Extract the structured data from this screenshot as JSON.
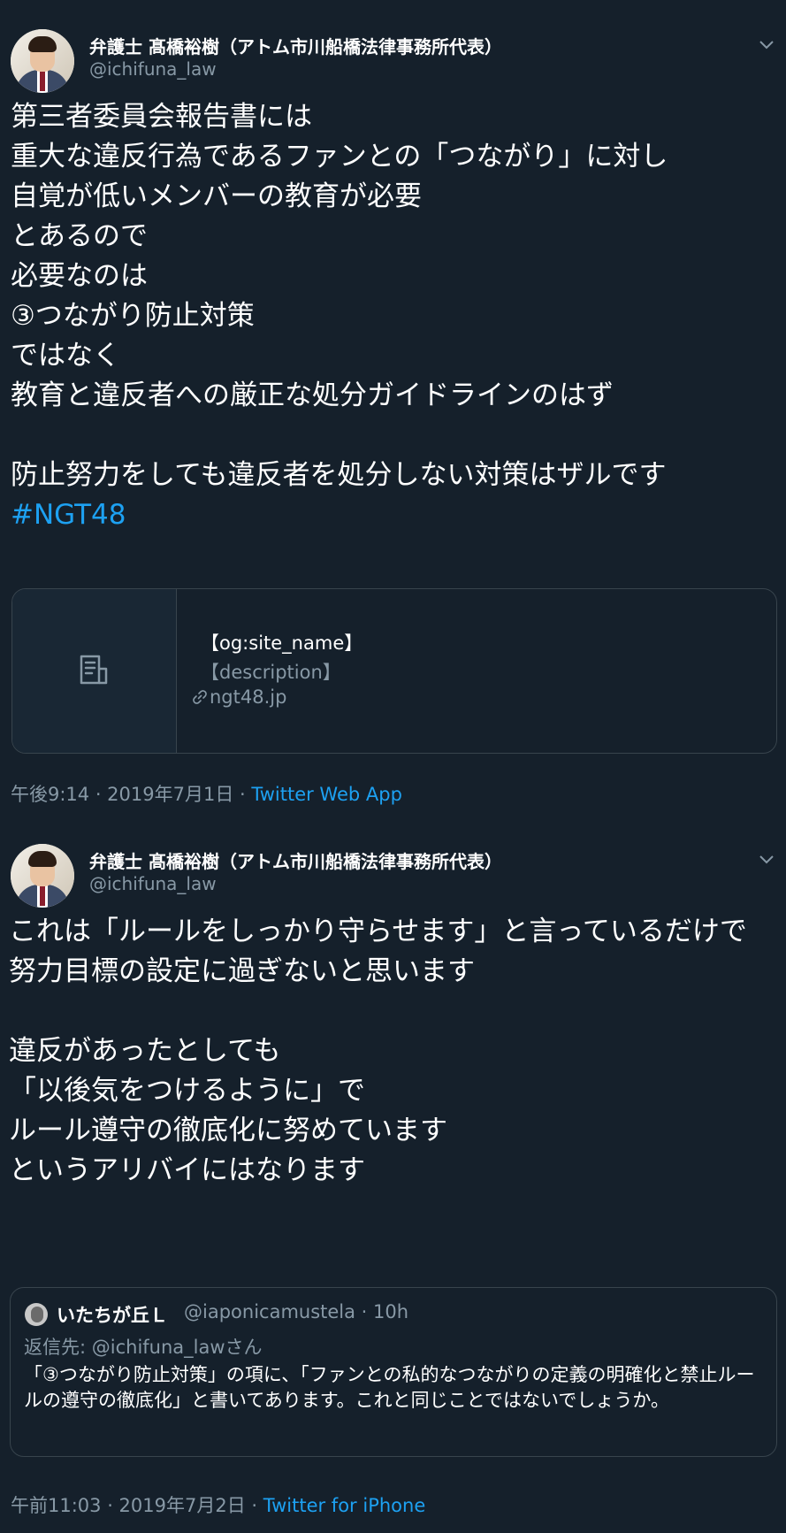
{
  "tweets": [
    {
      "name": "弁護士 髙橋裕樹（アトム市川船橋法律事務所代表）",
      "handle": "@ichifuna_law",
      "text": "第三者委員会報告書には\n重大な違反行為であるファンとの「つながり」に対し\n自覚が低いメンバーの教育が必要\nとあるので\n必要なのは\n③つながり防止対策\nではなく\n教育と違反者への厳正な処分ガイドラインのはず\n\n防止努力をしても違反者を処分しない対策はザルです\n",
      "hashtag": "#NGT48",
      "card": {
        "site_name": "【og:site_name】",
        "description": "【description】",
        "domain": "ngt48.jp"
      },
      "timestamp": "午後9:14 · 2019年7月1日 · ",
      "source": "Twitter Web App"
    },
    {
      "name": "弁護士 髙橋裕樹（アトム市川船橋法律事務所代表）",
      "handle": "@ichifuna_law",
      "text": "これは「ルールをしっかり守らせます」と言っているだけで\n努力目標の設定に過ぎないと思います\n\n違反があったとしても\n「以後気をつけるように」で\nルール遵守の徹底化に努めています\nというアリバイにはなります",
      "quote": {
        "name": "いたちが丘Ｌ",
        "handle_time": "@iaponicamustela · 10h",
        "reply_to": "返信先: @ichifuna_lawさん",
        "text": "「③つながり防止対策」の項に、「ファンとの私的なつながりの定義の明確化と禁止ルールの遵守の徹底化」と書いてあります。これと同じことではないでしょうか。"
      },
      "timestamp": "午前11:03 · 2019年7月2日 · ",
      "source": "Twitter for iPhone"
    }
  ],
  "icons": {
    "more": "chevron-down-icon",
    "card_placeholder": "document-icon",
    "link": "link-icon"
  },
  "colors": {
    "background": "#15202b",
    "text": "#ffffff",
    "secondary": "#8899a6",
    "accent": "#1da1f2",
    "border": "#38444d"
  }
}
